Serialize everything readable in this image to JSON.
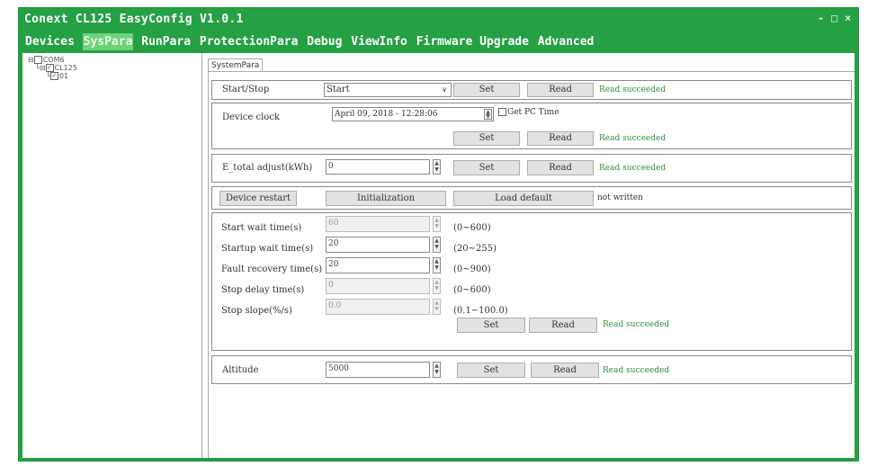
{
  "window": {
    "title": "Conext CL125 EasyConfig V1.0.1",
    "minimize": "-",
    "maximize": "□",
    "close": "×"
  },
  "menu": [
    "Devices",
    "SysPara",
    "RunPara",
    "ProtectionPara",
    "Debug",
    "ViewInfo",
    "Firmware Upgrade",
    "Advanced"
  ],
  "active_menu": "SysPara",
  "tree": {
    "root": "COM6",
    "child": "CL125",
    "leaf": "01"
  },
  "tab": "SystemPara",
  "start_stop": {
    "label": "Start/Stop",
    "value": "Start",
    "set": "Set",
    "read": "Read",
    "status": "Read succeeded"
  },
  "clock": {
    "label": "Device clock",
    "value": "April    09, 2018 - 12:28:06",
    "pc_time_label": "Get PC Time",
    "set": "Set",
    "read": "Read",
    "status": "Read succeeded"
  },
  "etotal": {
    "label": "E_total adjust(kWh)",
    "value": "0",
    "set": "Set",
    "read": "Read",
    "status": "Read succeeded"
  },
  "actions": {
    "restart": "Device restart",
    "init": "Initialization",
    "load_default": "Load default",
    "status": "not written"
  },
  "params": [
    {
      "label": "Start wait time(s)",
      "value": "60",
      "range": "(0~600)",
      "enabled": false
    },
    {
      "label": "Startup wait time(s)",
      "value": "20",
      "range": "(20~255)",
      "enabled": true
    },
    {
      "label": "Fault recovery time(s)",
      "value": "20",
      "range": "(0~900)",
      "enabled": true
    },
    {
      "label": "Stop delay time(s)",
      "value": "0",
      "range": "(0~600)",
      "enabled": false
    },
    {
      "label": "Stop slope(%/s)",
      "value": "0.0",
      "range": "(0.1~100.0)",
      "enabled": false
    }
  ],
  "params_buttons": {
    "set": "Set",
    "read": "Read",
    "status": "Read succeeded"
  },
  "altitude": {
    "label": "Altitude",
    "value": "5000",
    "set": "Set",
    "read": "Read",
    "status": "Read succeeded"
  }
}
